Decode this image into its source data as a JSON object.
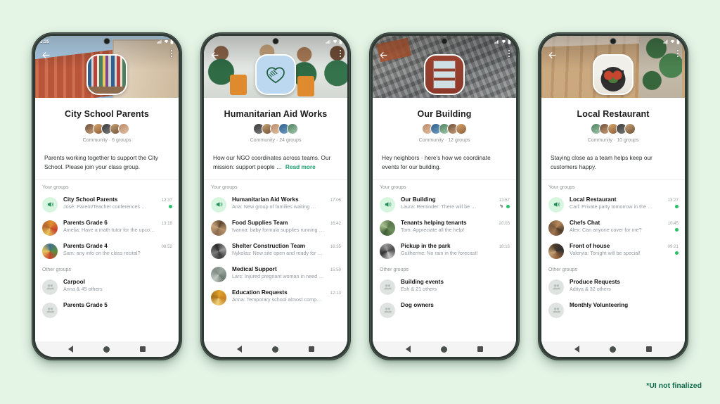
{
  "page": {
    "background_color": "#e4f5e6",
    "footnote": "*UI not finalized",
    "accent_color": "#1f9d6e",
    "unread_dot_color": "#25c162"
  },
  "phones": [
    {
      "status_time": "3:35",
      "cover": "school-building-photo",
      "avatar": "bookshelf-photo",
      "title": "City School Parents",
      "meta": "Community · 6 groups",
      "description": "Parents working together to support the City School. Please join your class group.",
      "read_more": "",
      "sections": [
        {
          "label": "Your groups",
          "rows": [
            {
              "name": "City School Parents",
              "time": "12:37",
              "message": "José: Parent/Teacher conferences …",
              "avatar": "announcement-megaphone",
              "unread": true,
              "pinned": false
            },
            {
              "name": "Parents Grade 6",
              "time": "13:18",
              "message": "Amelia: Have a math tutor for the upco…",
              "avatar": "photo-autumn",
              "unread": false,
              "pinned": false
            },
            {
              "name": "Parents Grade 4",
              "time": "08:52",
              "message": "Sam: any info on the class recital?",
              "avatar": "photo-group",
              "unread": false,
              "pinned": false
            }
          ]
        },
        {
          "label": "Other groups",
          "rows": [
            {
              "name": "Carpool",
              "time": "",
              "message": "Anna & 45 others",
              "avatar": "group-placeholder",
              "unread": false,
              "pinned": false
            },
            {
              "name": "Parents Grade 5",
              "time": "",
              "message": "",
              "avatar": "group-placeholder",
              "unread": false,
              "pinned": false
            }
          ]
        }
      ]
    },
    {
      "status_time": "",
      "cover": "volunteers-packing-photo",
      "avatar": "heart-handshake-logo",
      "title": "Humanitarian Aid Works",
      "meta": "Community · 24 groups",
      "description": "How our NGO coordinates across teams. Our mission: support people …",
      "read_more": "Read more",
      "sections": [
        {
          "label": "Your groups",
          "rows": [
            {
              "name": "Humanitarian Aid Works",
              "time": "17:06",
              "message": "Ana: New group of families waiting …",
              "avatar": "announcement-megaphone",
              "unread": false,
              "pinned": false
            },
            {
              "name": "Food Supplies Team",
              "time": "16:42",
              "message": "Ivanna: baby formula supplies running …",
              "avatar": "photo-supplies",
              "unread": false,
              "pinned": false
            },
            {
              "name": "Shelter Construction Team",
              "time": "16:35",
              "message": "Nykolas: New site open and ready for …",
              "avatar": "photo-shelter",
              "unread": false,
              "pinned": false
            },
            {
              "name": "Medical Support",
              "time": "15:59",
              "message": "Lars: Injured pregnant woman in need …",
              "avatar": "photo-medical",
              "unread": false,
              "pinned": false
            },
            {
              "name": "Education Requests",
              "time": "12:13",
              "message": "Anna: Temporary school almost comp…",
              "avatar": "photo-education",
              "unread": false,
              "pinned": false
            }
          ]
        }
      ]
    },
    {
      "status_time": "",
      "cover": "city-aerial-photo",
      "avatar": "brick-building-photo",
      "title": "Our Building",
      "meta": "Community · 12 groups",
      "description": "Hey neighbors · here's how we coordinate events for our building.",
      "read_more": "",
      "sections": [
        {
          "label": "Your groups",
          "rows": [
            {
              "name": "Our Building",
              "time": "13:57",
              "message": "Laura: Reminder: There will be …",
              "avatar": "announcement-megaphone",
              "unread": true,
              "pinned": true
            },
            {
              "name": "Tenants helping tenants",
              "time": "20:03",
              "message": "Tom: Appreciate all the help!",
              "avatar": "photo-plants",
              "unread": false,
              "pinned": false
            },
            {
              "name": "Pickup in the park",
              "time": "18:16",
              "message": "Guilherme: No rain in the forecast!",
              "avatar": "photo-park",
              "unread": false,
              "pinned": false
            }
          ]
        },
        {
          "label": "Other groups",
          "rows": [
            {
              "name": "Building events",
              "time": "",
              "message": "Esh & 21 others",
              "avatar": "group-placeholder",
              "unread": false,
              "pinned": false
            },
            {
              "name": "Dog owners",
              "time": "",
              "message": "",
              "avatar": "group-placeholder",
              "unread": false,
              "pinned": false
            }
          ]
        }
      ]
    },
    {
      "status_time": "",
      "cover": "restaurant-interior-photo",
      "avatar": "food-plate-photo",
      "title": "Local Restaurant",
      "meta": "Community · 10 groups",
      "description": "Staying close as a team helps keep our customers happy.",
      "read_more": "",
      "sections": [
        {
          "label": "Your groups",
          "rows": [
            {
              "name": "Local Restaurant",
              "time": "13:27",
              "message": "Carl: Private party tomorrow in the …",
              "avatar": "announcement-megaphone",
              "unread": true,
              "pinned": false
            },
            {
              "name": "Chefs Chat",
              "time": "10:45",
              "message": "Alex: Can anyone cover for me?",
              "avatar": "photo-chefs",
              "unread": true,
              "pinned": false
            },
            {
              "name": "Front of house",
              "time": "09:21",
              "message": "Valeryia: Tonight will be special!",
              "avatar": "photo-front",
              "unread": true,
              "pinned": false
            }
          ]
        },
        {
          "label": "Other groups",
          "rows": [
            {
              "name": "Produce Requests",
              "time": "",
              "message": "Aditya & 32 others",
              "avatar": "group-placeholder",
              "unread": false,
              "pinned": false
            },
            {
              "name": "Monthly Volunteering",
              "time": "",
              "message": "",
              "avatar": "group-placeholder",
              "unread": false,
              "pinned": false
            }
          ]
        }
      ]
    }
  ]
}
